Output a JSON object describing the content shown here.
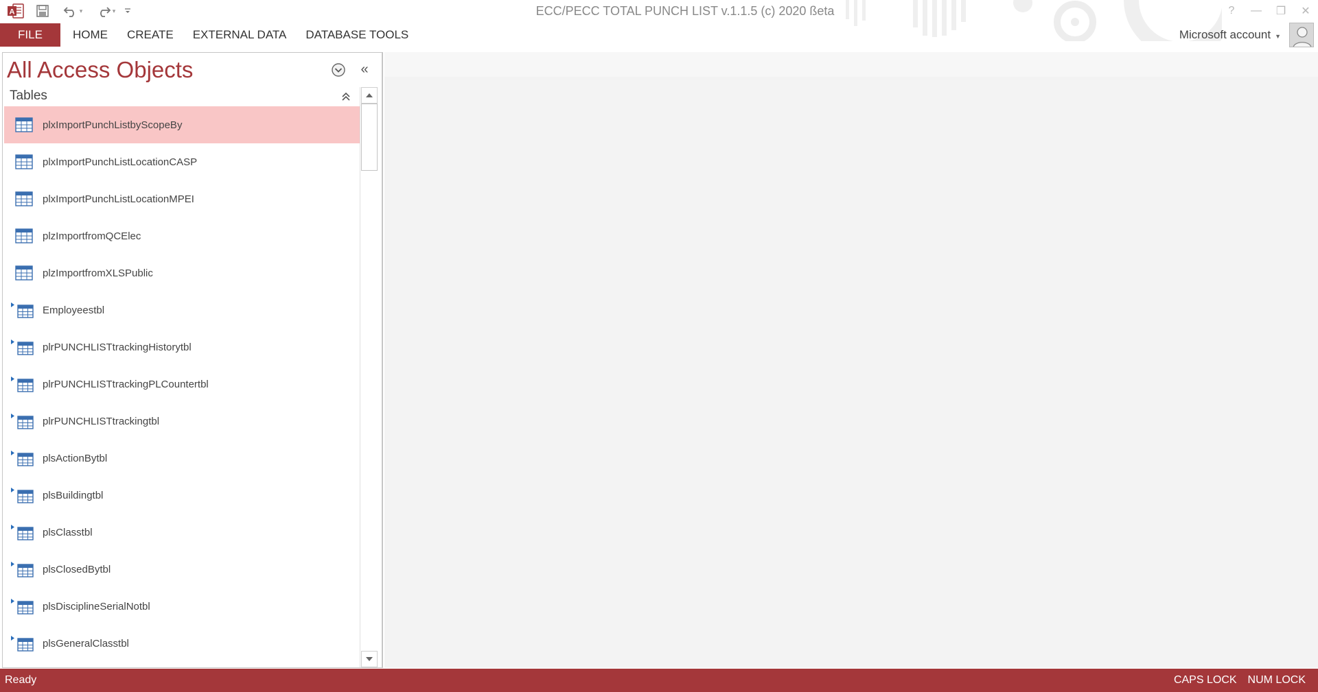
{
  "window": {
    "title": "ECC/PECC TOTAL PUNCH LIST v.1.1.5 (c) 2020 ßeta",
    "help_glyph": "?",
    "minimize_glyph": "—",
    "restore_glyph": "❐",
    "close_glyph": "✕"
  },
  "ribbon": {
    "tabs": [
      "FILE",
      "HOME",
      "CREATE",
      "EXTERNAL DATA",
      "DATABASE TOOLS"
    ],
    "account": "Microsoft account"
  },
  "nav": {
    "title": "All Access Objects",
    "collapse_glyph": "«",
    "group": "Tables",
    "items": [
      {
        "label": "plxImportPunchListbyScopeBy",
        "linked": false,
        "selected": true
      },
      {
        "label": "plxImportPunchListLocationCASP",
        "linked": false,
        "selected": false
      },
      {
        "label": "plxImportPunchListLocationMPEI",
        "linked": false,
        "selected": false
      },
      {
        "label": "plzImportfromQCElec",
        "linked": false,
        "selected": false
      },
      {
        "label": "plzImportfromXLSPublic",
        "linked": false,
        "selected": false
      },
      {
        "label": "Employeestbl",
        "linked": true,
        "selected": false
      },
      {
        "label": "plrPUNCHLISTtrackingHistorytbl",
        "linked": true,
        "selected": false
      },
      {
        "label": "plrPUNCHLISTtrackingPLCountertbl",
        "linked": true,
        "selected": false
      },
      {
        "label": "plrPUNCHLISTtrackingtbl",
        "linked": true,
        "selected": false
      },
      {
        "label": "plsActionBytbl",
        "linked": true,
        "selected": false
      },
      {
        "label": "plsBuildingtbl",
        "linked": true,
        "selected": false
      },
      {
        "label": "plsClasstbl",
        "linked": true,
        "selected": false
      },
      {
        "label": "plsClosedBytbl",
        "linked": true,
        "selected": false
      },
      {
        "label": "plsDisciplineSerialNotbl",
        "linked": true,
        "selected": false
      },
      {
        "label": "plsGeneralClasstbl",
        "linked": true,
        "selected": false
      }
    ]
  },
  "status": {
    "left": "Ready",
    "caps": "CAPS LOCK",
    "num": "NUM LOCK"
  },
  "colors": {
    "accent": "#a4373a",
    "selected_row": "#f9c6c6"
  },
  "icons": {
    "app": "access-app-icon",
    "save": "save-icon",
    "undo": "undo-icon",
    "redo": "redo-icon",
    "table": "table-icon",
    "linked_table": "linked-table-icon"
  }
}
